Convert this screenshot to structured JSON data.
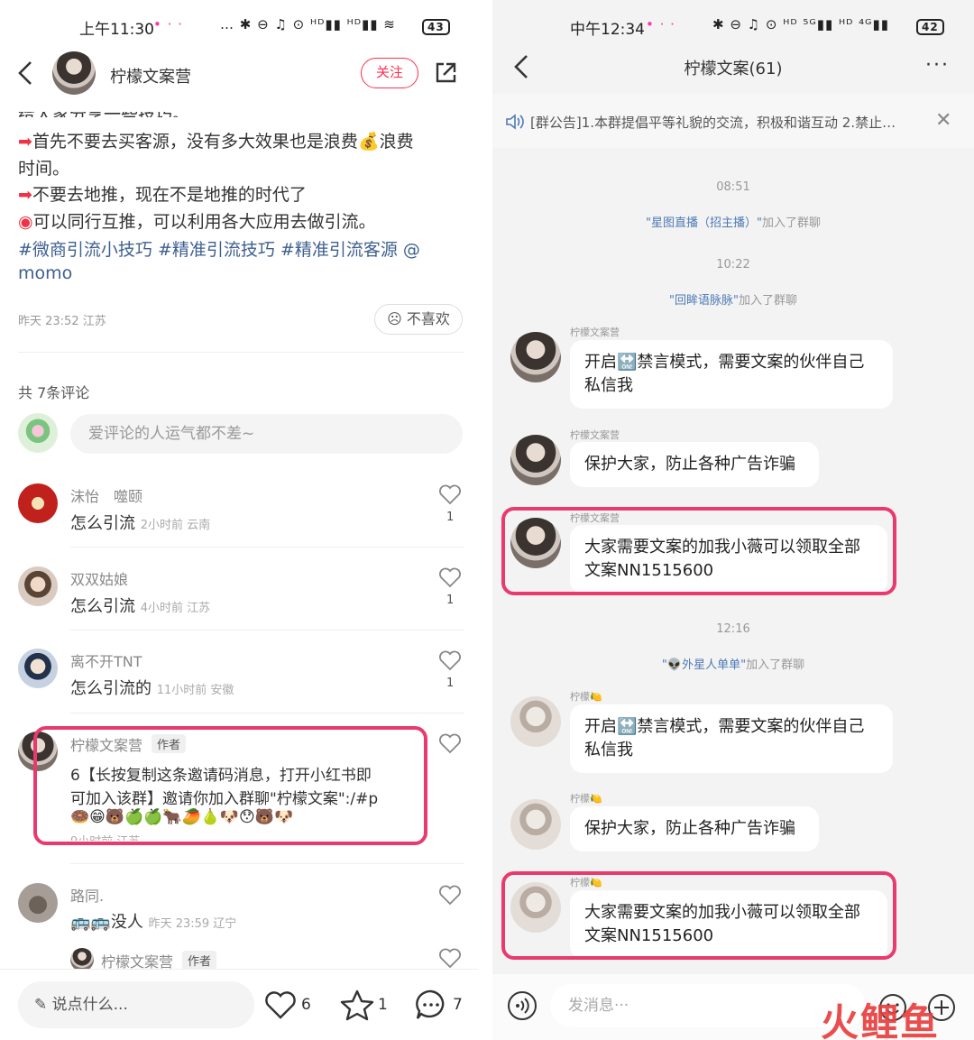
{
  "left": {
    "status_time": "上午11:30",
    "status_icons": "… ✱ ⊖ ♫ ⊙ ᴴᴰ▮▮ ᴴᴰ▮▮ ≋",
    "battery": "43",
    "author": "柠檬文案营",
    "follow": "关注",
    "post": {
      "line0": "给大家分享一些技巧。",
      "line1": "首先不要去买客源，没有多大效果也是浪费",
      "line1b": "浪费",
      "line2": "时间。",
      "line3": "不要去地推，现在不是地推的时代了",
      "line4": "可以同行互推，可以利用各大应用去做引流。",
      "tags1": "#微商引流小技巧 #精准引流技巧 #精准引流客源 @",
      "tags2": "momo",
      "meta": "昨天 23:52 江苏",
      "dislike": "不喜欢"
    },
    "comment_count": "共 7条评论",
    "comment_placeholder": "爱评论的人运气都不差~",
    "comments": [
      {
        "name": "沫怡　噬颐",
        "text": "怎么引流",
        "time": "2小时前  云南",
        "likes": "1"
      },
      {
        "name": "双双姑娘",
        "text": "怎么引流",
        "time": "4小时前  江苏",
        "likes": "1"
      },
      {
        "name": "离不开TNT",
        "text": "怎么引流的",
        "time": "11小时前  安徽",
        "likes": "1"
      },
      {
        "name": "柠檬文案营",
        "badge": "作者",
        "text1": "6【长按复制这条邀请码消息，打开小红书即",
        "text2": "可加入该群】邀请你加入群聊\"柠檬文案\":/#p",
        "emoji": "🍩😁🐻🍏🍏🐂🥭🍐🐶😯🐻🐶",
        "time": "9小时前  江苏"
      },
      {
        "name": "路同.",
        "text": "没人",
        "emoji": "🚌🚌",
        "time": "昨天 23:59 辽宁"
      },
      {
        "name": "柠檬文案营",
        "badge": "作者"
      }
    ],
    "bottom": {
      "input": "说点什么...",
      "likes": "6",
      "stars": "1",
      "comments": "7"
    }
  },
  "right": {
    "status_time": "中午12:34",
    "status_icons": "✱ ⊖ ♫ ⊙ ᴴᴰ ⁵ᴳ▮▮ ᴴᴰ ⁴ᴳ▮▮",
    "battery": "42",
    "title": "柠檬文案(61)",
    "notice": "[群公告]1.本群提倡平等礼貌的交流，积极和谐互动 2.禁止…",
    "messages": [
      {
        "type": "time",
        "text": "08:51"
      },
      {
        "type": "join",
        "name": "\"星图直播（招主播）\"",
        "suffix": "加入了群聊"
      },
      {
        "type": "time",
        "text": "10:22"
      },
      {
        "type": "join",
        "name": "\"回眸语脉脉\"",
        "suffix": "加入了群聊"
      },
      {
        "type": "msg",
        "sender": "柠檬文案营",
        "l1": "开启🔛禁言模式，需要文案的伙伴自己",
        "l2": "私信我"
      },
      {
        "type": "msg",
        "sender": "柠檬文案营",
        "l1": "保护大家，防止各种广告诈骗"
      },
      {
        "type": "msg",
        "sender": "柠檬文案营",
        "l1": "大家需要文案的加我小薇可以领取全部",
        "l2": "文案NN1515600"
      },
      {
        "type": "time",
        "text": "12:16"
      },
      {
        "type": "join",
        "name": "\"👽外星人单单\"",
        "suffix": "加入了群聊"
      },
      {
        "type": "msg",
        "sender": "柠檬🍋",
        "l1": "开启🔛禁言模式，需要文案的伙伴自己",
        "l2": "私信我"
      },
      {
        "type": "msg",
        "sender": "柠檬🍋",
        "l1": "保护大家，防止各种广告诈骗"
      },
      {
        "type": "msg",
        "sender": "柠檬🍋",
        "l1": "大家需要文案的加我小薇可以领取全部",
        "l2": "文案NN1515600"
      }
    ],
    "input_placeholder": "发消息···"
  },
  "watermark": "火鲤鱼",
  "colors": {
    "accent": "#e83a6e",
    "tag": "#3e5f8f",
    "bg_chat": "#f3f3f3"
  }
}
